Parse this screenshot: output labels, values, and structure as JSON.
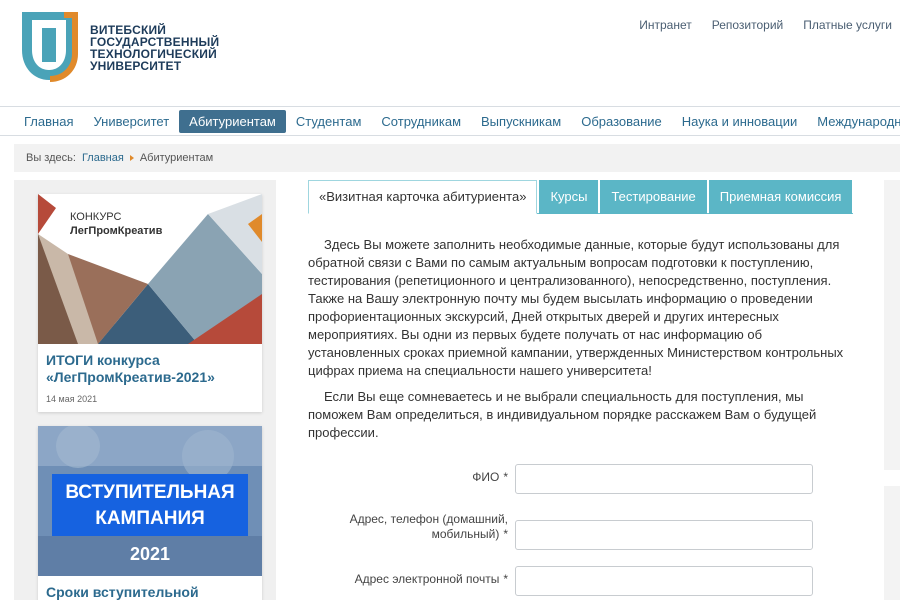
{
  "site": {
    "logo_lines": [
      "ВИТЕБСКИЙ",
      "ГОСУДАРСТВЕННЫЙ",
      "ТЕХНОЛОГИЧЕСКИЙ",
      "УНИВЕРСИТЕТ"
    ],
    "top_links": [
      "Интранет",
      "Репозиторий",
      "Платные услуги"
    ]
  },
  "nav": {
    "items": [
      "Главная",
      "Университет",
      "Абитуриентам",
      "Студентам",
      "Сотрудникам",
      "Выпускникам",
      "Образование",
      "Наука и инновации",
      "Международное со"
    ],
    "active_index": 2
  },
  "breadcrumb": {
    "prefix": "Вы здесь:",
    "home": "Главная",
    "current": "Абитуриентам"
  },
  "sidebar": {
    "card1": {
      "img_line1": "КОНКУРС",
      "img_line2": "ЛегПромКреатив",
      "title": "ИТОГИ конкурса «ЛегПромКреатив-2021»",
      "date": "14 мая 2021"
    },
    "card2": {
      "img_line1": "ВСТУПИТЕЛЬНАЯ",
      "img_line2": "КАМПАНИЯ",
      "img_year": "2021",
      "title": "Сроки вступительной"
    }
  },
  "tabs": [
    "«Визитная карточка абитуриента»",
    "Курсы",
    "Тестирование",
    "Приемная комиссия"
  ],
  "content": {
    "paragraph1": "Здесь Вы можете заполнить необходимые данные, которые будут использованы для обратной связи с Вами по самым актуальным вопросам подготовки к поступлению, тестирования (репетиционного и централизованного), непосредственно, поступления. Также на Вашу электронную почту мы будем высылать информацию о проведении профориентационных экскурсий, Дней открытых дверей и других интересных мероприятиях. Вы одни из первых будете получать от нас информацию об установленных сроках приемной кампании, утвержденных Министерством контрольных цифрах приема на специальности нашего университета!",
    "paragraph2": "Если Вы еще сомневаетесь и не выбрали специальность для поступления, мы поможем Вам определиться, в индивидуальном порядке расскажем Вам о будущей профессии."
  },
  "form": {
    "fio_label": "ФИО",
    "fio_value": "",
    "address_label": "Адрес, телефон (домашний, мобильный)",
    "address_value": "",
    "email_label": "Адрес электронной почты",
    "email_value": "",
    "required_mark": "*"
  },
  "colors": {
    "brand_blue": "#1d3b5a",
    "logo_teal": "#4aa3b8",
    "logo_orange": "#e08a2b",
    "nav_active": "#3f6f8f",
    "tab_bg": "#5bb6c6",
    "card_title": "#2c6a8e"
  }
}
